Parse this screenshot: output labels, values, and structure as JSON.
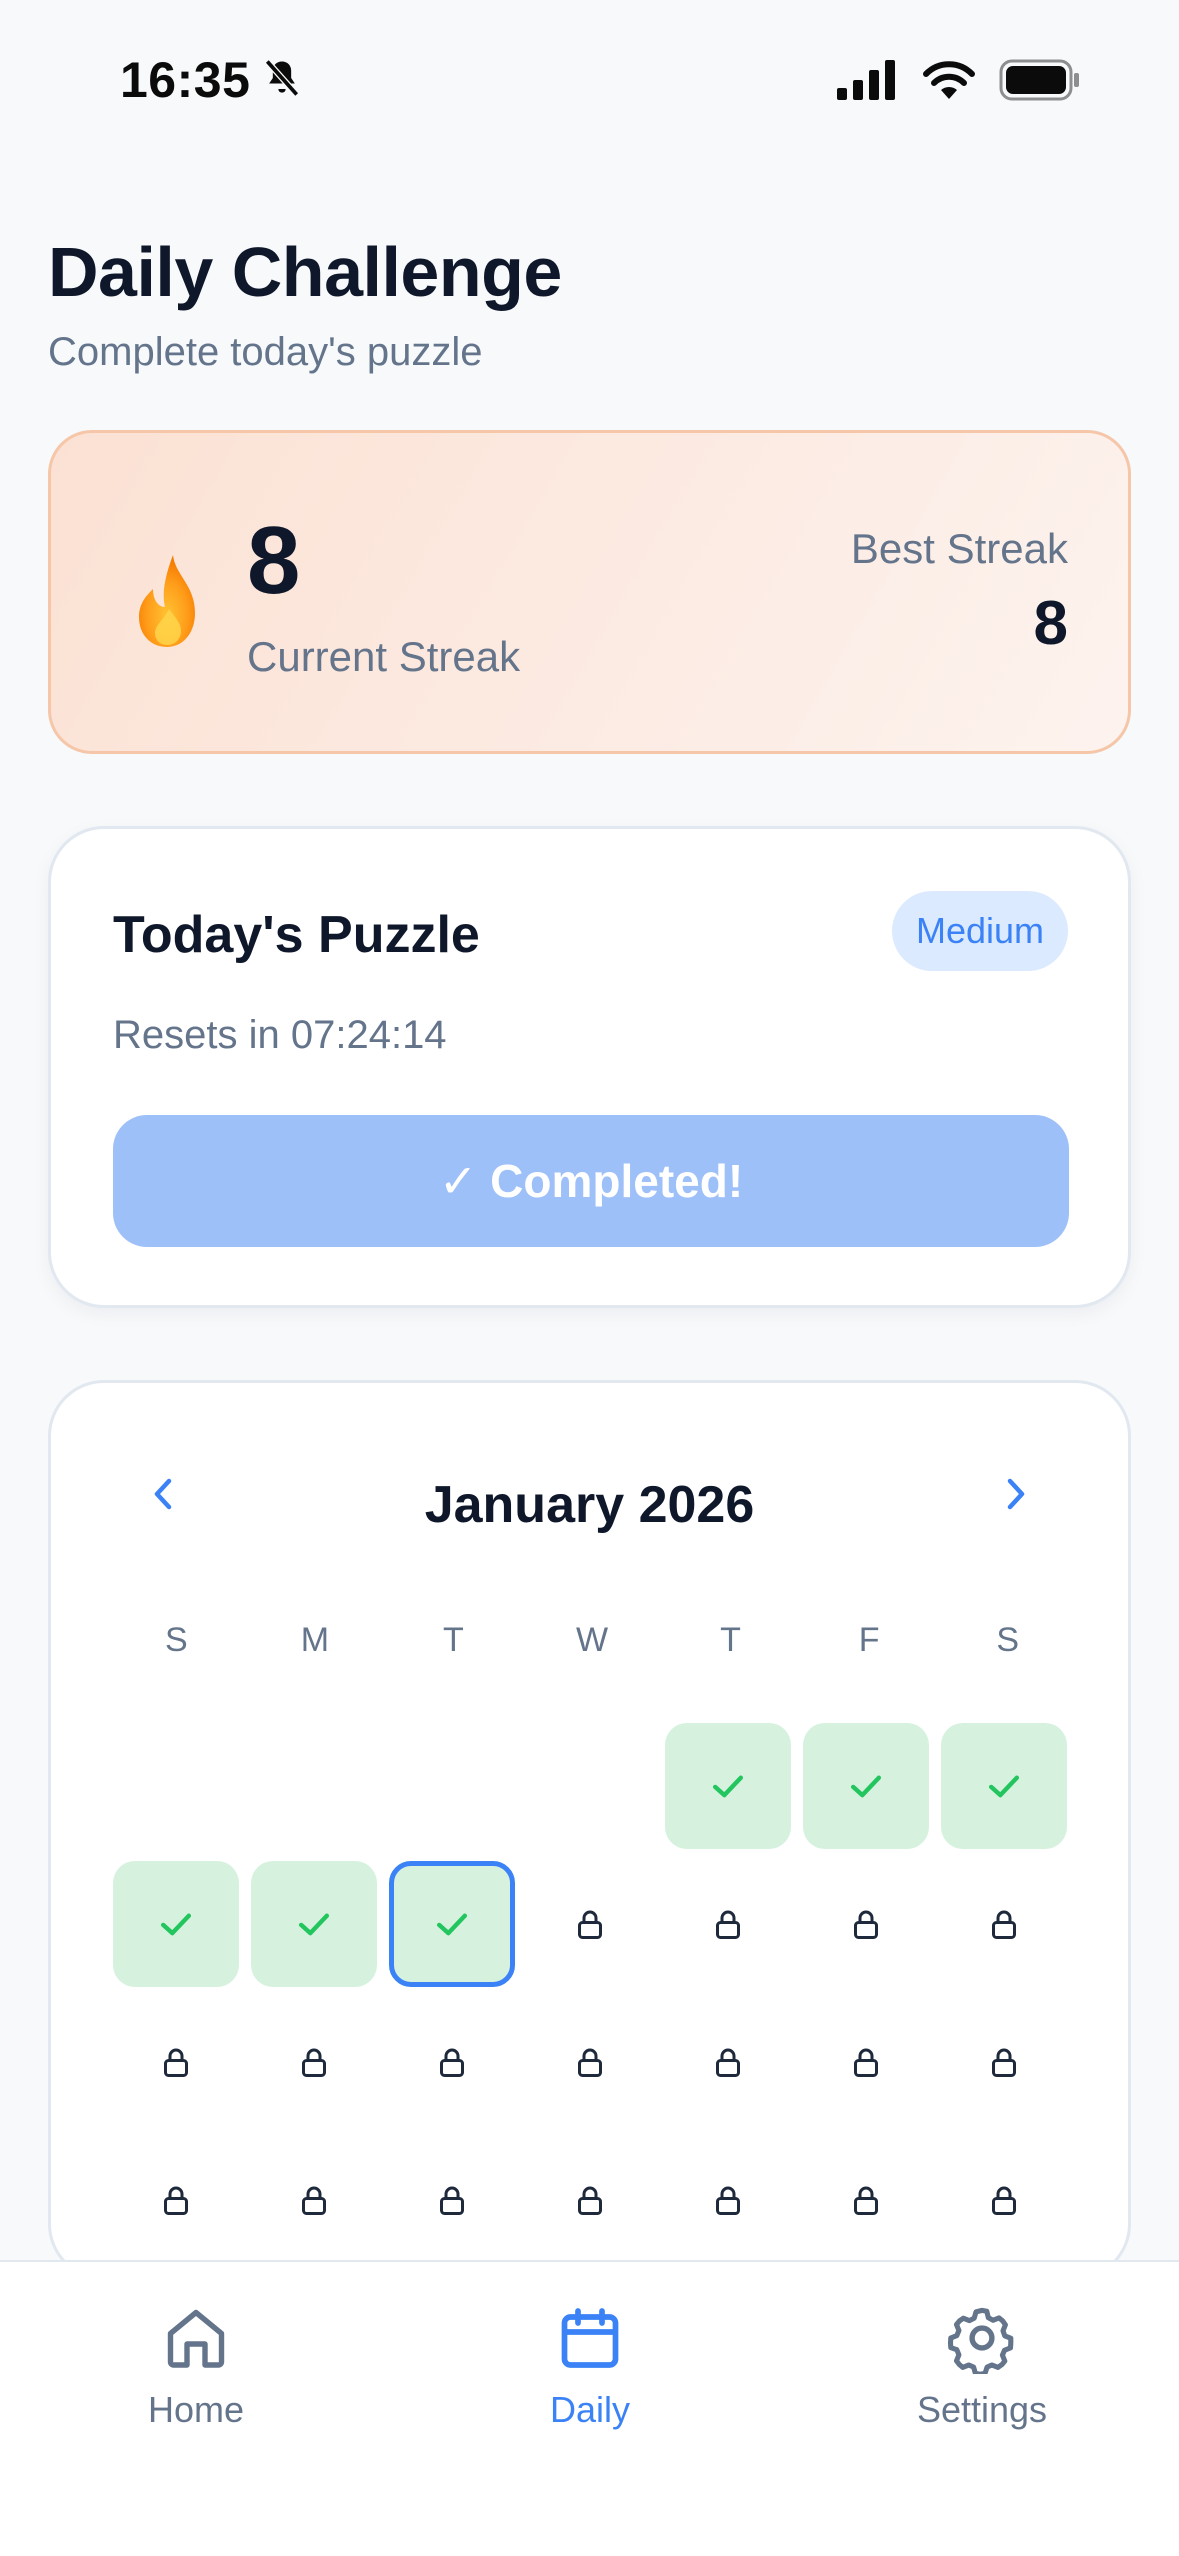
{
  "status_bar": {
    "time": "16:35",
    "icons": [
      "bell-slash-icon",
      "cellular-signal-icon",
      "wifi-icon",
      "battery-icon"
    ]
  },
  "header": {
    "title": "Daily Challenge",
    "subtitle": "Complete today's puzzle"
  },
  "streak": {
    "current_value": "8",
    "current_label": "Current Streak",
    "best_label": "Best Streak",
    "best_value": "8",
    "icon": "flame-icon"
  },
  "puzzle": {
    "title": "Today's Puzzle",
    "difficulty": "Medium",
    "reset_text": "Resets in 07:24:14",
    "button_label": "✓ Completed!"
  },
  "calendar": {
    "month_label": "January 2026",
    "weekdays": [
      "S",
      "M",
      "T",
      "W",
      "T",
      "F",
      "S"
    ],
    "leading_blank_days": 4,
    "days": [
      {
        "status": "completed"
      },
      {
        "status": "completed"
      },
      {
        "status": "completed"
      },
      {
        "status": "completed"
      },
      {
        "status": "completed"
      },
      {
        "status": "completed",
        "today": true
      },
      {
        "status": "locked"
      },
      {
        "status": "locked"
      },
      {
        "status": "locked"
      },
      {
        "status": "locked"
      },
      {
        "status": "locked"
      },
      {
        "status": "locked"
      },
      {
        "status": "locked"
      },
      {
        "status": "locked"
      },
      {
        "status": "locked"
      },
      {
        "status": "locked"
      },
      {
        "status": "locked"
      },
      {
        "status": "locked"
      },
      {
        "status": "locked"
      },
      {
        "status": "locked"
      },
      {
        "status": "locked"
      },
      {
        "status": "locked"
      },
      {
        "status": "locked"
      },
      {
        "status": "locked"
      },
      {
        "status": "locked"
      }
    ]
  },
  "bottom_nav": {
    "items": [
      {
        "label": "Home",
        "icon": "home-icon",
        "active": false
      },
      {
        "label": "Daily",
        "icon": "calendar-icon",
        "active": true
      },
      {
        "label": "Settings",
        "icon": "gear-icon",
        "active": false
      }
    ]
  },
  "colors": {
    "accent": "#3b82f6",
    "completed_bg": "#d6f2df",
    "check": "#22c55e",
    "streak_bg": "#fbe1d3",
    "button_bg": "#9ec0f8"
  }
}
